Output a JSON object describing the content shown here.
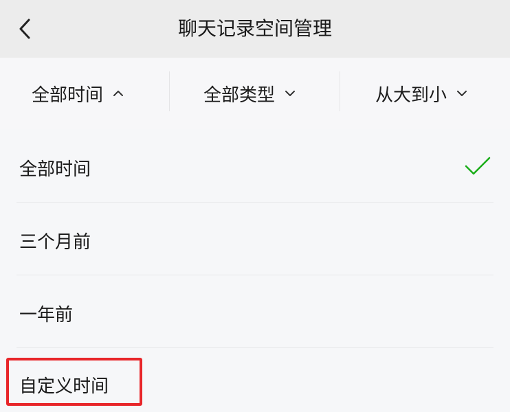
{
  "header": {
    "title": "聊天记录空间管理",
    "back_icon": "chevron-left-icon"
  },
  "filters": [
    {
      "label": "全部时间",
      "icon": "chevron-up-icon",
      "expanded": true
    },
    {
      "label": "全部类型",
      "icon": "chevron-down-icon",
      "expanded": false
    },
    {
      "label": "从大到小",
      "icon": "chevron-down-icon",
      "expanded": false
    }
  ],
  "time_options": [
    {
      "label": "全部时间",
      "selected": true,
      "icon": "checkmark-icon"
    },
    {
      "label": "三个月前",
      "selected": false
    },
    {
      "label": "一年前",
      "selected": false
    },
    {
      "label": "自定义时间",
      "selected": false,
      "highlighted": true
    }
  ],
  "colors": {
    "check": "#1aad19",
    "highlight_box": "#e8262a",
    "header_bg": "#ececec",
    "list_bg": "#f6f7f9"
  }
}
